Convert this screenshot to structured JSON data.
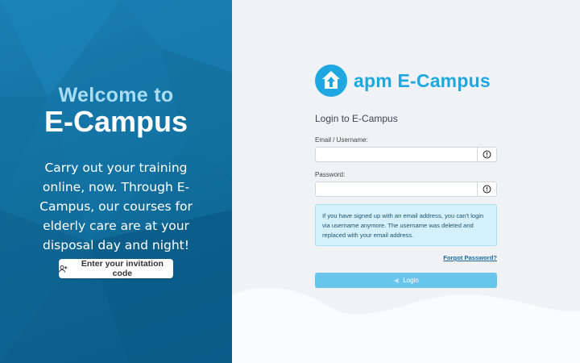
{
  "hero": {
    "welcome": "Welcome to",
    "title": "E-Campus",
    "tagline": "Carry out your training online, now. Through E-Campus, our courses for elderly care are at your disposal day and night!",
    "invite_button": "Enter your invitation code",
    "invite_icon": "user-plus-icon"
  },
  "login": {
    "logo_text": "apm E-Campus",
    "logo_icon": "house-arrow-icon",
    "heading": "Login to E-Campus",
    "username_label": "Email / Username:",
    "username_value": "",
    "password_label": "Password:",
    "password_value": "",
    "field_addon_icon": "exclamation-circle-icon",
    "info_text": "If you have signed up with an email address, you can't login via username anymore. The username was deleted and replaced with your email address.",
    "forgot_link": "Forgot Password?",
    "login_button": "Login",
    "login_icon": "sign-in-icon"
  },
  "colors": {
    "hero_bg": "#1677ab",
    "brand": "#1ea7e1",
    "welcome": "#a9ddf4",
    "info_bg": "#d4f1fb",
    "button_bg": "#68c5ec",
    "link": "#1a6a9e"
  }
}
